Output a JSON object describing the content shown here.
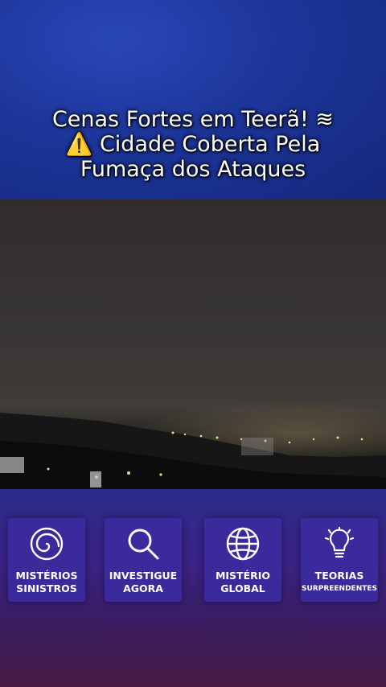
{
  "title": {
    "line1": "Cenas Fortes em Teerã! ≋",
    "line2": "⚠️ Cidade Coberta Pela",
    "line3": "Fumaça dos Ataques"
  },
  "cards": [
    {
      "icon": "spiral-icon",
      "line1": "MISTÉRIOS",
      "line2": "SINISTROS"
    },
    {
      "icon": "magnifier-icon",
      "line1": "INVESTIGUE",
      "line2": "AGORA"
    },
    {
      "icon": "globe-icon",
      "line1": "MISTÉRIO",
      "line2": "GLOBAL"
    },
    {
      "icon": "lightbulb-icon",
      "line1": "TEORIAS",
      "line2": "SURPREENDENTES"
    }
  ]
}
